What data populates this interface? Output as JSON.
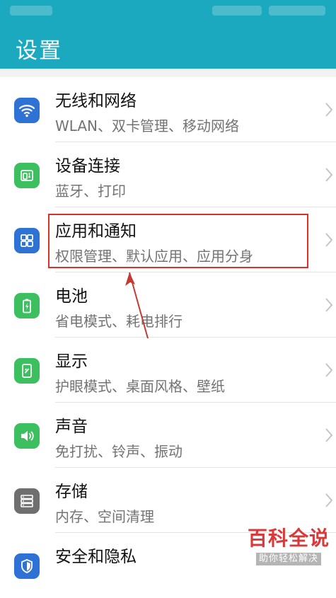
{
  "header": {
    "title": "设置"
  },
  "colors": {
    "header_bg": "#1aa9bf",
    "icon_blue": "#2f72d6",
    "icon_green": "#3cbf5f",
    "icon_gray": "#6f6f6f",
    "highlight": "#d9322b",
    "watermark": "#d8393a"
  },
  "settings": {
    "items": [
      {
        "title": "无线和网络",
        "subtitle": "WLAN、双卡管理、移动网络",
        "icon": "wifi-icon"
      },
      {
        "title": "设备连接",
        "subtitle": "蓝牙、打印",
        "icon": "device-connection-icon"
      },
      {
        "title": "应用和通知",
        "subtitle": "权限管理、默认应用、应用分身",
        "icon": "apps-grid-icon"
      },
      {
        "title": "电池",
        "subtitle": "省电模式、耗电排行",
        "icon": "battery-icon"
      },
      {
        "title": "显示",
        "subtitle": "护眼模式、桌面风格、壁纸",
        "icon": "display-icon"
      },
      {
        "title": "声音",
        "subtitle": "免打扰、铃声、振动",
        "icon": "speaker-icon"
      },
      {
        "title": "存储",
        "subtitle": "内存、空间清理",
        "icon": "storage-icon"
      },
      {
        "title": "安全和隐私",
        "subtitle": "",
        "icon": "shield-icon"
      }
    ]
  },
  "watermark": {
    "brand": "百科全说",
    "slogan": "助你轻松解决"
  }
}
